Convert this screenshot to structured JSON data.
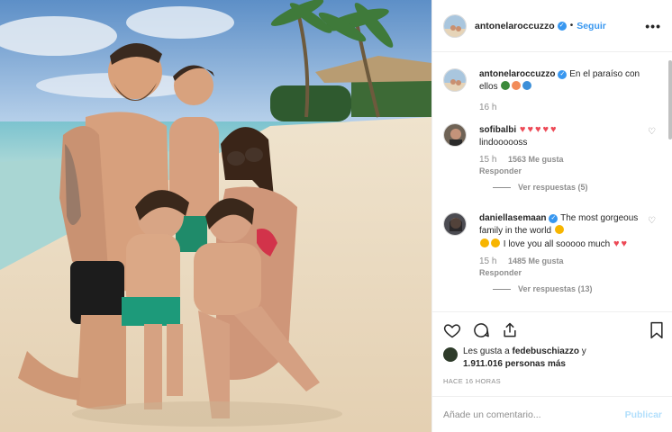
{
  "post": {
    "author": "antonelaroccuzzo",
    "separator": "•",
    "follow_label": "Seguir",
    "more_label": "•••",
    "caption_text": "En el paraíso con ellos",
    "caption_time": "16 h"
  },
  "comments": [
    {
      "user": "sofibalbi",
      "line2": "lindoooooss",
      "time": "15 h",
      "likes": "1563 Me gusta",
      "reply": "Responder",
      "see_replies": "Ver respuestas (5)"
    },
    {
      "user": "daniellasemaan",
      "text_1": "The most gorgeous family in the world",
      "text_2": "I love you all sooooo much",
      "time": "15 h",
      "likes": "1485 Me gusta",
      "reply": "Responder",
      "see_replies": "Ver respuestas (13)"
    }
  ],
  "likes": {
    "prefix": "Les gusta a",
    "user": "fedebuschiazzo",
    "conj": "y",
    "count": "1.911.016 personas más"
  },
  "timestamp": "HACE 16 HORAS",
  "add_comment": {
    "placeholder": "Añade un comentario...",
    "publish": "Publicar"
  },
  "icons": [
    "verified-badge-icon",
    "heart-icon",
    "comment-icon",
    "share-icon",
    "bookmark-icon",
    "more-options-icon",
    "palm-tree-emoji",
    "shell-emoji",
    "wave-emoji",
    "heart-emoji",
    "heart-eyes-emoji",
    "smiling-face-emoji"
  ],
  "colors": {
    "accent": "#3897f0",
    "heart": "#ed4956",
    "muted": "#8e8e8e",
    "publish_disabled": "#b2dffc"
  }
}
